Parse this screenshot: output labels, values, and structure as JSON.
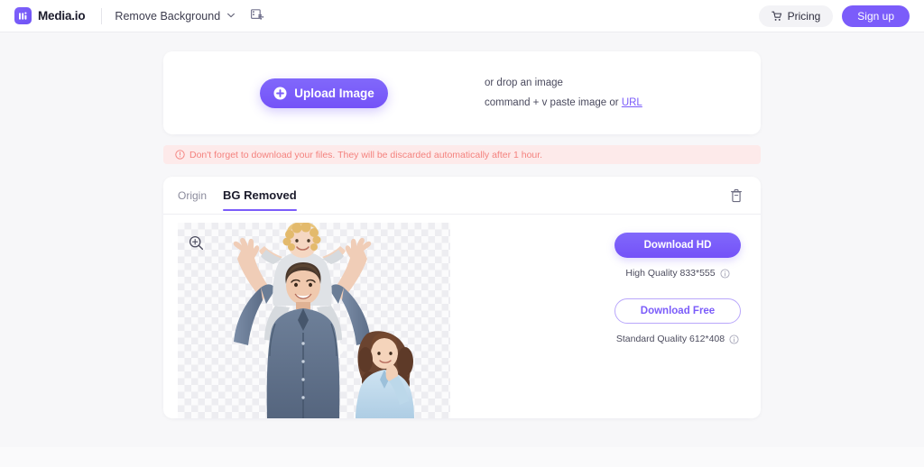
{
  "header": {
    "brand_name": "Media.io",
    "brand_logo_icon": "media-io-logo",
    "tool_label": "Remove Background",
    "tool_chevron_icon": "chevron-down-icon",
    "tool_extra_icon": "image-edit-icon",
    "pricing_label": "Pricing",
    "pricing_icon": "cart-icon",
    "signup_label": "Sign up"
  },
  "upload": {
    "button_label": "Upload Image",
    "button_icon": "plus-circle-icon",
    "drop_line1": "or drop an image",
    "drop_line2_prefix": "command + v paste image or ",
    "drop_line2_link": "URL"
  },
  "warning": {
    "icon": "alert-circle-icon",
    "text": "Don't forget to download your files. They will be discarded automatically after 1 hour."
  },
  "result": {
    "tabs": [
      {
        "label": "Origin",
        "active": false
      },
      {
        "label": "BG Removed",
        "active": true
      }
    ],
    "delete_icon": "trash-icon",
    "preview": {
      "zoom_icon": "zoom-in-icon",
      "alt": "family-photo-background-removed"
    },
    "download_hd_label": "Download HD",
    "hd_quality_text": "High Quality 833*555",
    "hd_info_icon": "info-icon",
    "download_free_label": "Download Free",
    "free_quality_text": "Standard Quality 612*408",
    "free_info_icon": "info-icon"
  },
  "colors": {
    "accent_purple": "#7b5cfa",
    "page_background": "#f7f7f9",
    "card_background": "#ffffff",
    "warning_background": "#fdeaea",
    "warning_text": "#f4827e",
    "tab_active_underline": "#7b5cfa"
  }
}
